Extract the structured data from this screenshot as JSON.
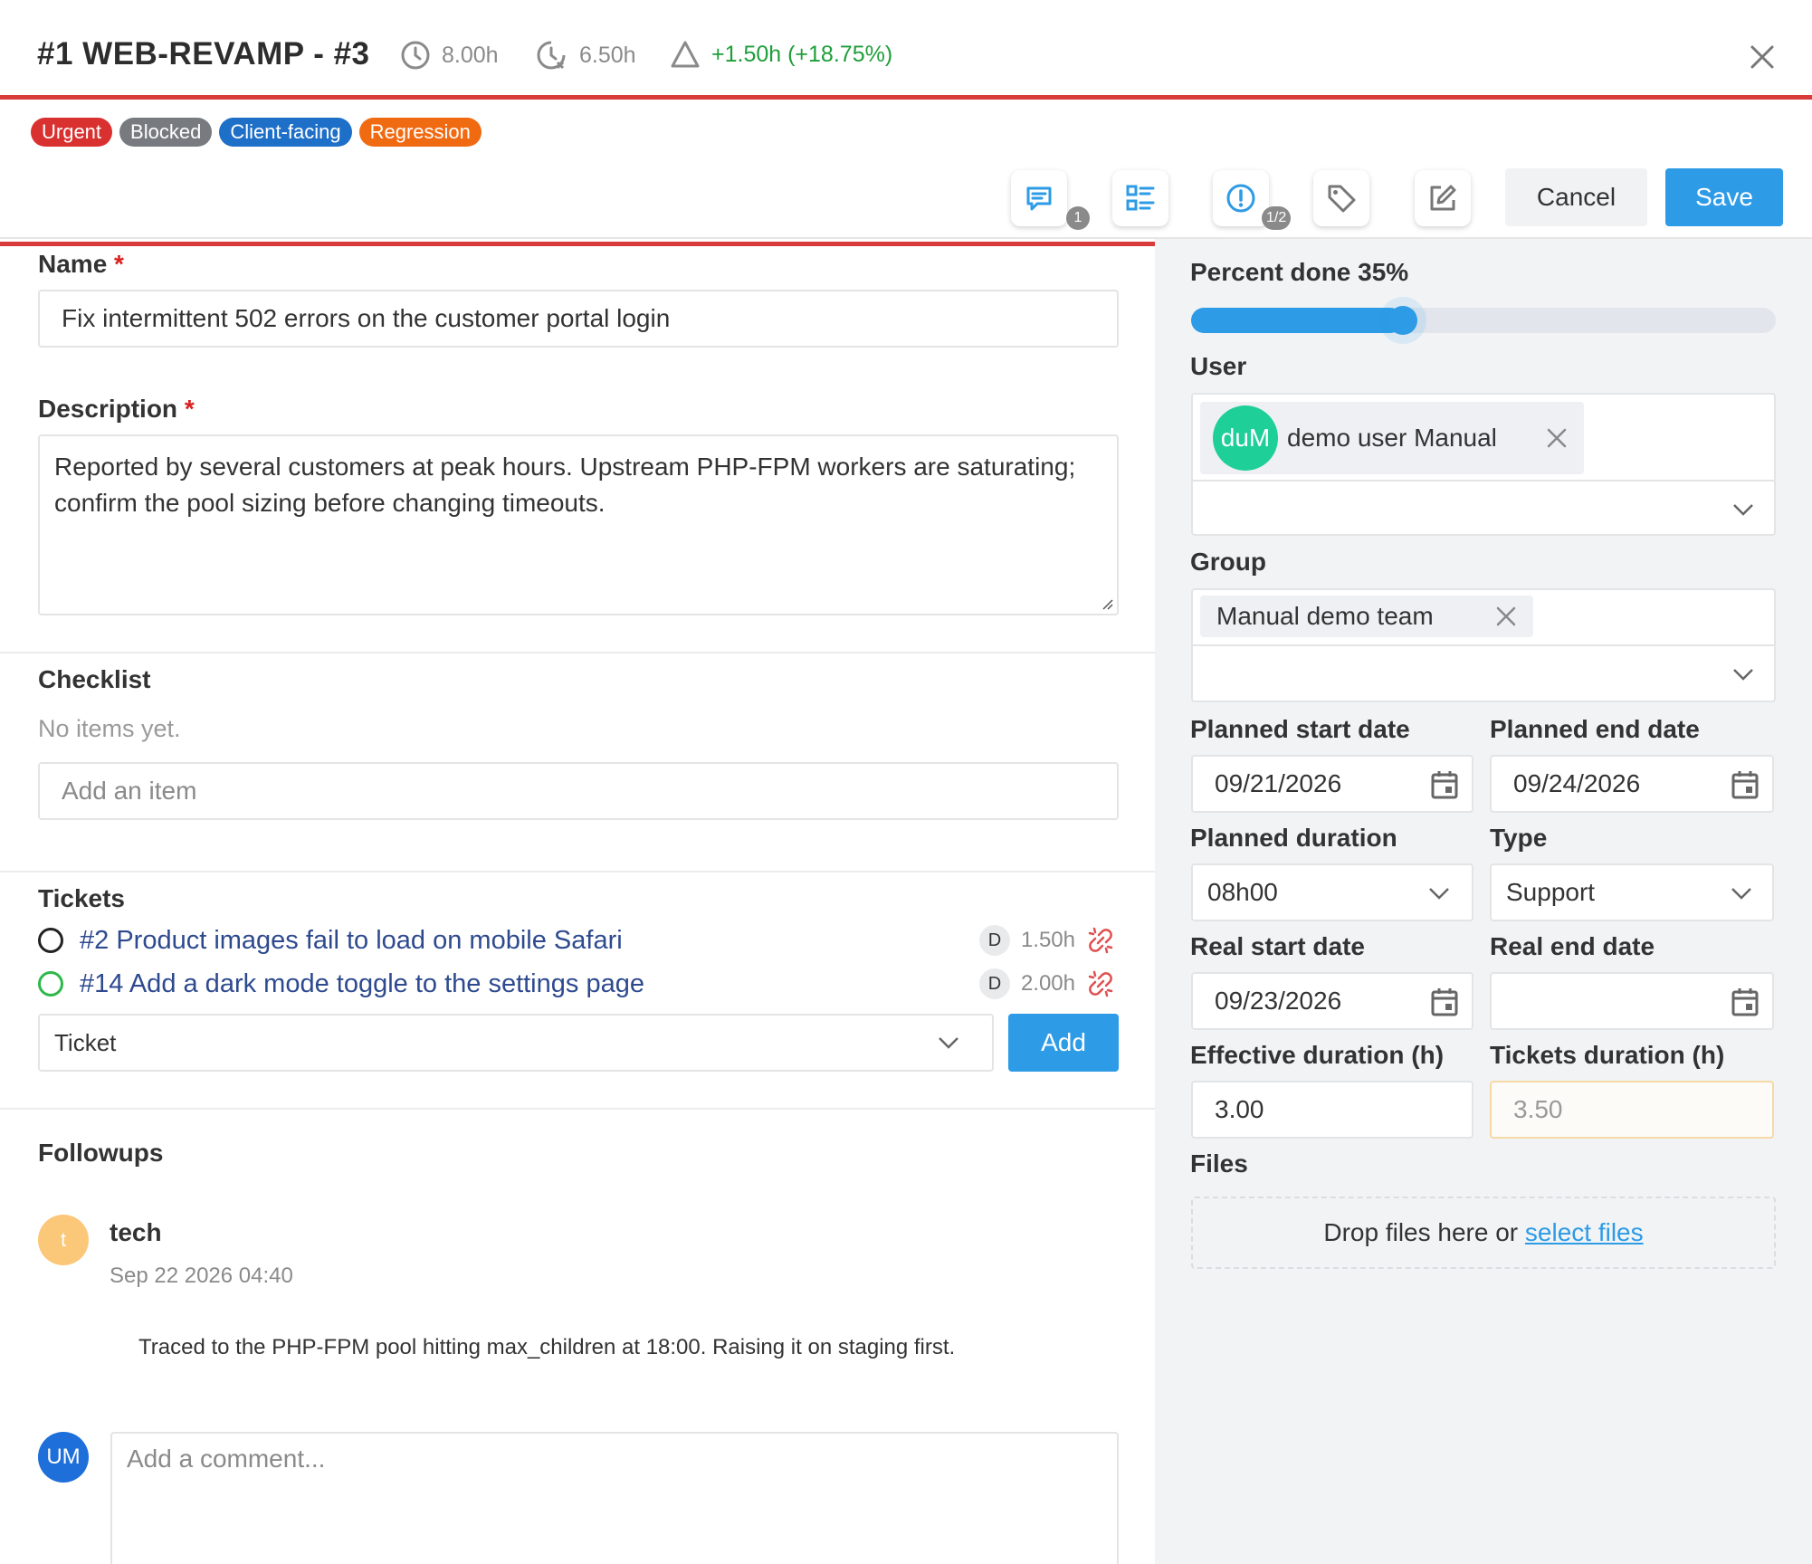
{
  "header": {
    "title": "#1 WEB-REVAMP - #3",
    "planned_time": "8.00h",
    "actual_time": "6.50h",
    "diff": "+1.50h (+18.75%)"
  },
  "tags": [
    {
      "label": "Urgent",
      "color": "#d93030"
    },
    {
      "label": "Blocked",
      "color": "#777b80"
    },
    {
      "label": "Client-facing",
      "color": "#1e6fc7"
    },
    {
      "label": "Regression",
      "color": "#f06a12"
    }
  ],
  "toolbar": {
    "comments_badge": "1",
    "alerts_badge": "1/2",
    "cancel_label": "Cancel",
    "save_label": "Save"
  },
  "form": {
    "name_label": "Name",
    "name_value": "Fix intermittent 502 errors on the customer portal login",
    "required_mark": "*",
    "description_label": "Description",
    "description_value": "Reported by several customers at peak hours. Upstream PHP-FPM workers are saturating; confirm the pool sizing before changing timeouts.",
    "checklist_label": "Checklist",
    "checklist_empty": "No items yet.",
    "checklist_placeholder": "Add an item"
  },
  "tickets": {
    "label": "Tickets",
    "items": [
      {
        "title": "#2 Product images fail to load on mobile Safari",
        "initial": "D",
        "hours": "1.50h",
        "status_color": "#222222"
      },
      {
        "title": "#14 Add a dark mode toggle to the settings page",
        "initial": "D",
        "hours": "2.00h",
        "status_color": "#2eb84a"
      }
    ],
    "select_placeholder": "Ticket",
    "add_label": "Add"
  },
  "followups": {
    "label": "Followups",
    "author_initial": "t",
    "author": "tech",
    "date": "Sep 22 2026 04:40",
    "text": "Traced to the PHP-FPM pool hitting max_children at 18:00. Raising it on staging first.",
    "comment_avatar": "UM",
    "comment_placeholder": "Add a comment..."
  },
  "side": {
    "percent_label": "Percent done 35%",
    "percent_value": 0.35,
    "user_label": "User",
    "user_avatar": "duM",
    "user_name": "demo user Manual",
    "group_label": "Group",
    "group_name": "Manual demo team",
    "planned_start_label": "Planned start date",
    "planned_start_value": "09/21/2026",
    "planned_end_label": "Planned end date",
    "planned_end_value": "09/24/2026",
    "planned_duration_label": "Planned duration",
    "planned_duration_value": "08h00",
    "type_label": "Type",
    "type_value": "Support",
    "real_start_label": "Real start date",
    "real_start_value": "09/23/2026",
    "real_end_label": "Real end date",
    "real_end_value": "",
    "effective_label": "Effective duration (h)",
    "effective_value": "3.00",
    "tickets_duration_label": "Tickets duration (h)",
    "tickets_duration_value": "3.50",
    "files_label": "Files",
    "drop_text": "Drop files here or",
    "select_files": "select files"
  }
}
